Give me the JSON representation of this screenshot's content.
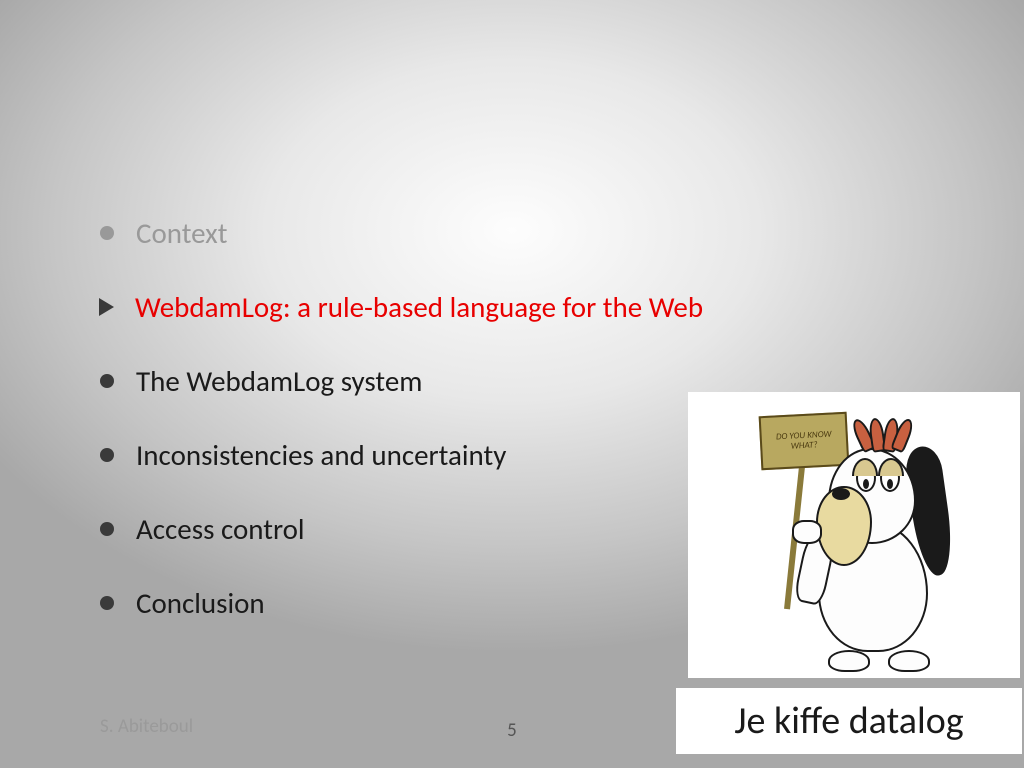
{
  "outline": {
    "items": [
      {
        "label": "Context",
        "state": "dim",
        "marker": "bullet"
      },
      {
        "label": "WebdamLog: a rule-based language for the Web",
        "state": "active",
        "marker": "triangle"
      },
      {
        "label": "The WebdamLog system",
        "state": "normal",
        "marker": "bullet"
      },
      {
        "label": "Inconsistencies and uncertainty",
        "state": "normal",
        "marker": "bullet"
      },
      {
        "label": "Access control",
        "state": "normal",
        "marker": "bullet"
      },
      {
        "label": "Conclusion",
        "state": "normal",
        "marker": "bullet"
      }
    ]
  },
  "illustration": {
    "sign_text": "DO YOU KNOW WHAT?",
    "caption": "Je kiffe datalog"
  },
  "footer": {
    "author": "S. Abiteboul",
    "page": "5"
  }
}
